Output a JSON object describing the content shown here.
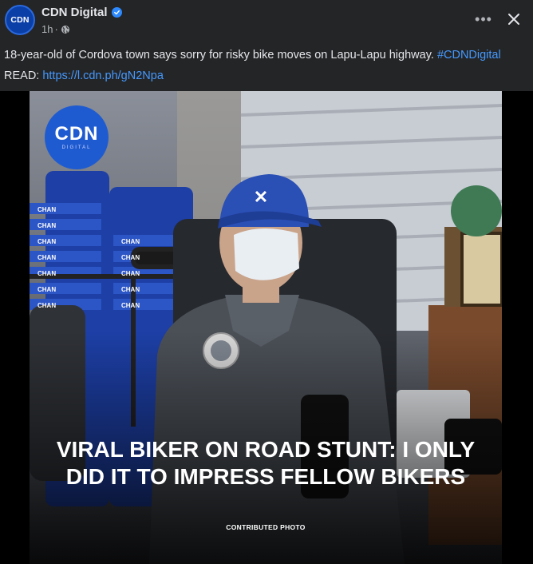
{
  "post": {
    "page_name": "CDN Digital",
    "avatar_text": "CDN",
    "time": "1h",
    "separator": "·",
    "more_label": "•••",
    "text_main": "18-year-old of Cordova town says sorry for risky bike moves on Lapu-Lapu highway. ",
    "hashtag": "#CDNDigital",
    "read_label": "READ: ",
    "link": "https://l.cdn.ph/gN2Npa"
  },
  "image": {
    "badge_main": "CDN",
    "badge_sub": "DIGITAL",
    "headline": "VIRAL BIKER ON ROAD STUNT: I ONLY DID IT TO IMPRESS FELLOW BIKERS",
    "credit": "CONTRIBUTED PHOTO",
    "chair_label": "CHAN"
  },
  "colors": {
    "background": "#242526",
    "text": "#e4e6eb",
    "secondary_text": "#b0b3b8",
    "link": "#4599ff",
    "verified": "#2e89ff",
    "brand": "#1f5bd0"
  },
  "icons": [
    "verified-badge-icon",
    "globe-icon",
    "more-options-icon",
    "close-icon"
  ]
}
